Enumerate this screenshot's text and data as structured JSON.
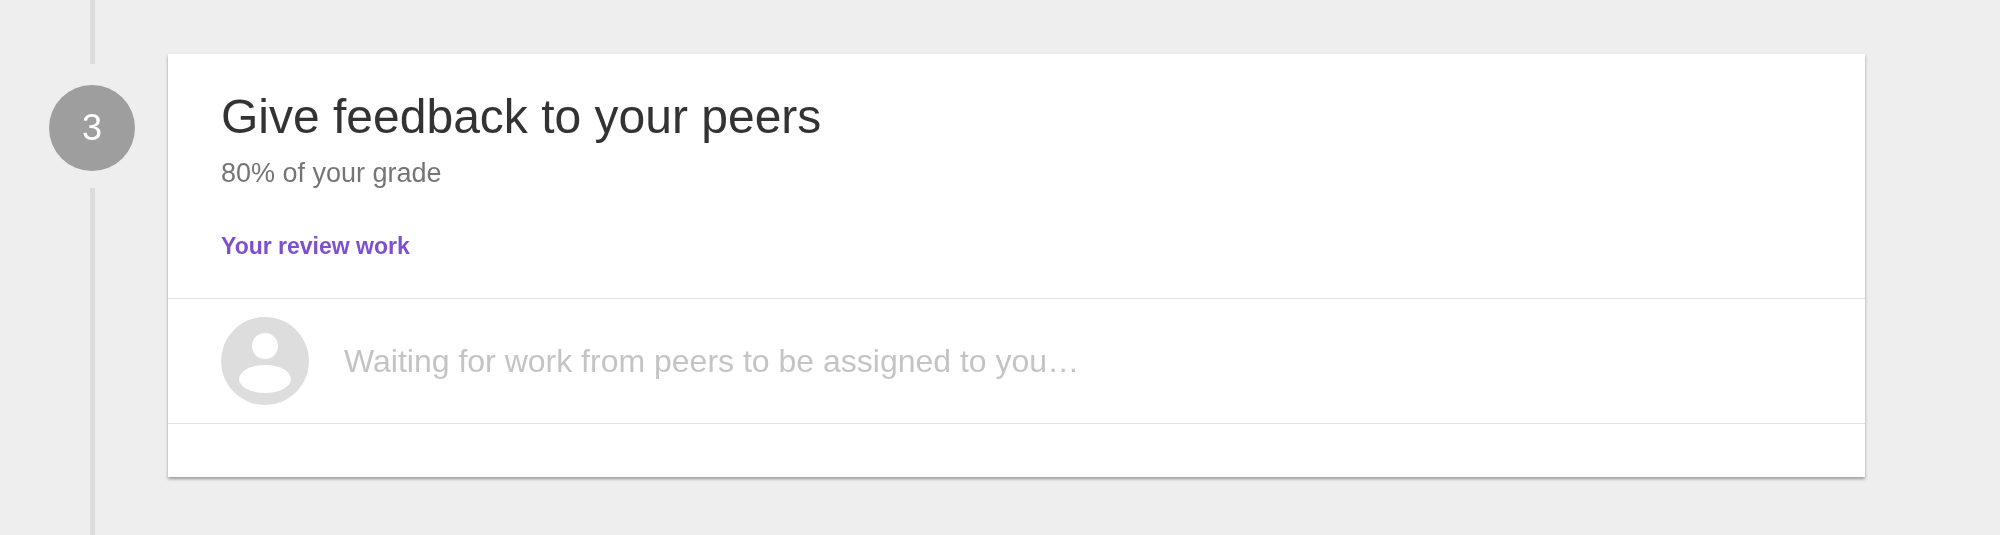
{
  "step": {
    "number": "3"
  },
  "card": {
    "title": "Give feedback to your peers",
    "subtitle": "80% of your grade",
    "section_label": "Your review work",
    "message": "Waiting for work from peers to be assigned to you…"
  }
}
